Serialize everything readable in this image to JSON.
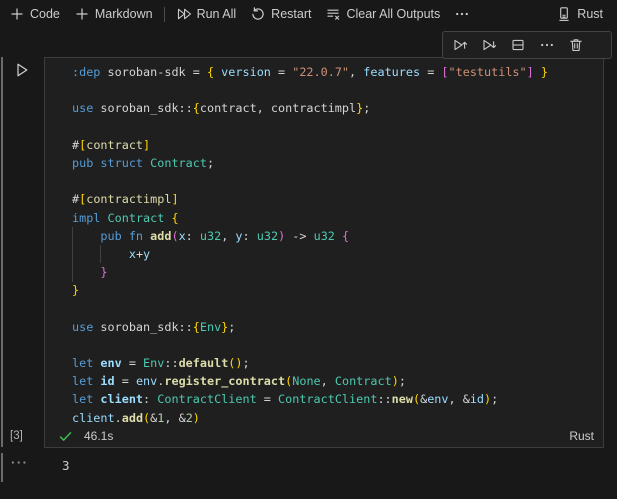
{
  "notebook_toolbar": {
    "code_label": "Code",
    "markdown_label": "Markdown",
    "run_all_label": "Run All",
    "restart_label": "Restart",
    "clear_all_outputs_label": "Clear All Outputs",
    "kernel_name": "Rust"
  },
  "cell_toolbar": {
    "icons": [
      "execute-above",
      "execute-cell-and-below",
      "split-cell",
      "more-actions",
      "delete-cell"
    ]
  },
  "cell": {
    "execution_count": "[3]",
    "status": {
      "success": true,
      "duration": "46.1s",
      "language": "Rust"
    },
    "code_lines": [
      [
        [
          "kw",
          ":dep"
        ],
        [
          "pn",
          " soroban-sdk = "
        ],
        [
          "b1",
          "{"
        ],
        [
          "var",
          " version "
        ],
        [
          "pn",
          "= "
        ],
        [
          "str",
          "\"22.0.7\""
        ],
        [
          "pn",
          ", "
        ],
        [
          "var",
          "features "
        ],
        [
          "pn",
          "= "
        ],
        [
          "b2",
          "["
        ],
        [
          "str",
          "\"testutils\""
        ],
        [
          "b2",
          "]"
        ],
        [
          "b1",
          " }"
        ]
      ],
      [],
      [
        [
          "kw",
          "use"
        ],
        [
          "pn",
          " soroban_sdk::"
        ],
        [
          "b1",
          "{"
        ],
        [
          "pn",
          "contract, contractimpl"
        ],
        [
          "b1",
          "}"
        ],
        [
          "pn",
          ";"
        ]
      ],
      [],
      [
        [
          "pn",
          "#"
        ],
        [
          "b1",
          "["
        ],
        [
          "fn",
          "contract"
        ],
        [
          "b1",
          "]"
        ]
      ],
      [
        [
          "kw",
          "pub struct"
        ],
        [
          "ty",
          " Contract"
        ],
        [
          "pn",
          ";"
        ]
      ],
      [],
      [
        [
          "pn",
          "#"
        ],
        [
          "b1",
          "["
        ],
        [
          "fn",
          "contractimpl"
        ],
        [
          "b1",
          "]"
        ]
      ],
      [
        [
          "kw",
          "impl"
        ],
        [
          "ty",
          " Contract "
        ],
        [
          "b1",
          "{"
        ]
      ],
      [
        [
          "pn",
          "    "
        ],
        [
          "kw",
          "pub fn "
        ],
        [
          "fnb",
          "add"
        ],
        [
          "b2",
          "("
        ],
        [
          "var",
          "x"
        ],
        [
          "pn",
          ": "
        ],
        [
          "ty",
          "u32"
        ],
        [
          "pn",
          ", "
        ],
        [
          "var",
          "y"
        ],
        [
          "pn",
          ": "
        ],
        [
          "ty",
          "u32"
        ],
        [
          "b2",
          ")"
        ],
        [
          "pn",
          " -> "
        ],
        [
          "ty",
          "u32 "
        ],
        [
          "b2",
          "{"
        ]
      ],
      [
        [
          "pn",
          "        "
        ],
        [
          "var",
          "x"
        ],
        [
          "pn",
          "+"
        ],
        [
          "var",
          "y"
        ]
      ],
      [
        [
          "pn",
          "    "
        ],
        [
          "b2",
          "}"
        ]
      ],
      [
        [
          "b1",
          "}"
        ]
      ],
      [],
      [
        [
          "kw",
          "use"
        ],
        [
          "pn",
          " soroban_sdk::"
        ],
        [
          "b1",
          "{"
        ],
        [
          "ty",
          "Env"
        ],
        [
          "b1",
          "}"
        ],
        [
          "pn",
          ";"
        ]
      ],
      [],
      [
        [
          "kw",
          "let "
        ],
        [
          "decl",
          "env"
        ],
        [
          "pn",
          " = "
        ],
        [
          "ty",
          "Env"
        ],
        [
          "pn",
          "::"
        ],
        [
          "fnb",
          "default"
        ],
        [
          "b1",
          "()"
        ],
        [
          "pn",
          ";"
        ]
      ],
      [
        [
          "kw",
          "let "
        ],
        [
          "decl",
          "id"
        ],
        [
          "pn",
          " = "
        ],
        [
          "var",
          "env"
        ],
        [
          "pn",
          "."
        ],
        [
          "fnb",
          "register_contract"
        ],
        [
          "b1",
          "("
        ],
        [
          "ty",
          "None"
        ],
        [
          "pn",
          ", "
        ],
        [
          "ty",
          "Contract"
        ],
        [
          "b1",
          ")"
        ],
        [
          "pn",
          ";"
        ]
      ],
      [
        [
          "kw",
          "let "
        ],
        [
          "decl",
          "client"
        ],
        [
          "pn",
          ": "
        ],
        [
          "ty",
          "ContractClient"
        ],
        [
          "pn",
          " = "
        ],
        [
          "ty",
          "ContractClient"
        ],
        [
          "pn",
          "::"
        ],
        [
          "fnb",
          "new"
        ],
        [
          "b1",
          "("
        ],
        [
          "pn",
          "&"
        ],
        [
          "var",
          "env"
        ],
        [
          "pn",
          ", &"
        ],
        [
          "var",
          "id"
        ],
        [
          "b1",
          ")"
        ],
        [
          "pn",
          ";"
        ]
      ],
      [
        [
          "var",
          "client"
        ],
        [
          "pn",
          "."
        ],
        [
          "fnb",
          "add"
        ],
        [
          "b1",
          "("
        ],
        [
          "pn",
          "&"
        ],
        [
          "num",
          "1"
        ],
        [
          "pn",
          ", &"
        ],
        [
          "num",
          "2"
        ],
        [
          "b1",
          ")"
        ]
      ]
    ]
  },
  "output": {
    "more_indicator": "···",
    "text": "3"
  },
  "colors": {
    "page_bg": "#181818",
    "editor_bg": "#1f1f1f",
    "cell_border": "#3c3c3c",
    "ui_text": "#cccccc",
    "success_green": "#3fb950",
    "syntax": {
      "keyword": "#569cd6",
      "type": "#4ec9b0",
      "function": "#dcdcaa",
      "variable": "#9cdcfe",
      "string": "#ce9178",
      "number": "#b5cea8",
      "punctuation": "#d4d4d4",
      "bracket_level1": "#ffd700",
      "bracket_level2": "#da70d6"
    }
  }
}
